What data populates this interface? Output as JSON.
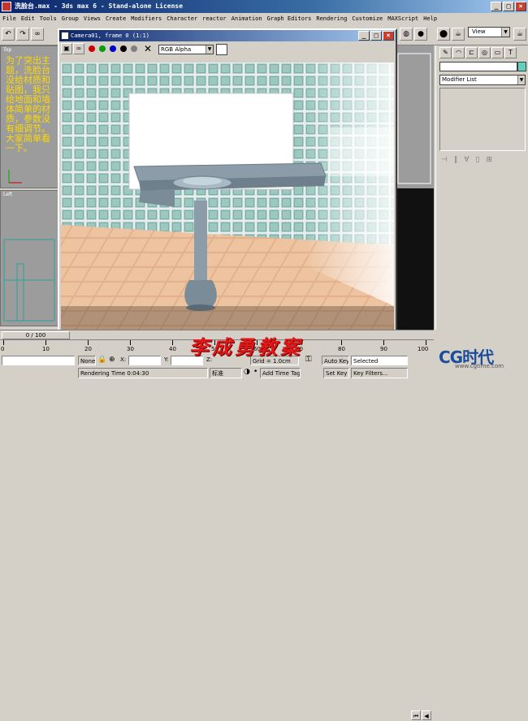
{
  "app": {
    "title": "洗脸台.max - 3ds max 6 - Stand-alone License",
    "window_buttons": [
      "_",
      "□",
      "×"
    ]
  },
  "menu": [
    "File",
    "Edit",
    "Tools",
    "Group",
    "Views",
    "Create",
    "Modifiers",
    "Character",
    "reactor",
    "Animation",
    "Graph Editors",
    "Rendering",
    "Customize",
    "MAXScript",
    "Help"
  ],
  "toolbar": {
    "view_selector": "View"
  },
  "viewports": {
    "top_label": "Top",
    "left_label": "Left",
    "note": "为了突出主题，洗脸台没给材质和贴图，我只给地面和墙体简单的材质，参数没有细调节。大家简单看一下。"
  },
  "render_frame": {
    "title": "Camera01, frame 0 (1:1)",
    "channel": "RGB Alpha",
    "channel_dots": [
      {
        "name": "red-channel-icon",
        "color": "#cc0000"
      },
      {
        "name": "green-channel-icon",
        "color": "#00a000"
      },
      {
        "name": "blue-channel-icon",
        "color": "#0000cc"
      },
      {
        "name": "alpha-channel-icon",
        "color": "#000000"
      },
      {
        "name": "mono-channel-icon",
        "color": "#808080"
      }
    ]
  },
  "command_panel": {
    "modifier_list": "Modifier List"
  },
  "timeline": {
    "slider": "0 / 100",
    "ticks": [
      "0",
      "10",
      "20",
      "30",
      "40",
      "50",
      "60",
      "70",
      "80",
      "90",
      "100"
    ]
  },
  "status": {
    "selection": "None",
    "x_label": "X:",
    "y_label": "Y:",
    "z_label": "Z:",
    "grid": "Grid = 1.0cm",
    "auto_key": "Auto Key",
    "key_mode": "Selected",
    "set_key": "Set Key",
    "key_filters": "Key Filters...",
    "rendering_time": "Rendering Time  0:04:30",
    "ime": "标准",
    "time_tag": "Add Time Tag"
  },
  "watermark": "李成勇教案",
  "logo": "CG时代",
  "logo_url": "www.cgtime.com"
}
